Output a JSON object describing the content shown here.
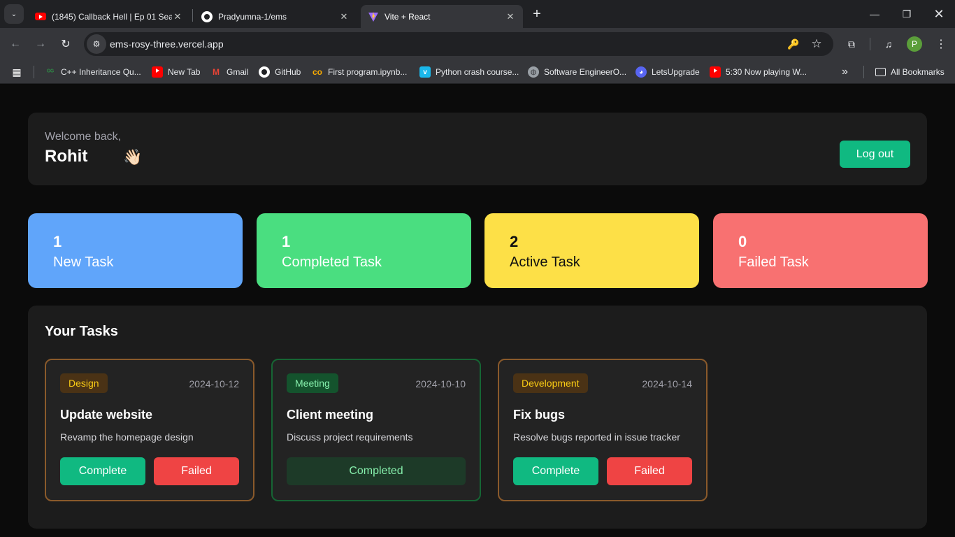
{
  "browser": {
    "tabs": [
      {
        "title": "(1845) Callback Hell | Ep 01 Sea",
        "favicon": "youtube-icon"
      },
      {
        "title": "Pradyumna-1/ems",
        "favicon": "github-icon"
      },
      {
        "title": "Vite + React",
        "favicon": "vite-icon"
      }
    ],
    "url": "ems-rosy-three.vercel.app",
    "profile_initial": "P",
    "bookmarks": [
      {
        "label": "C++ Inheritance Qu...",
        "icon": "gfg-icon"
      },
      {
        "label": "New Tab",
        "icon": "youtube-icon"
      },
      {
        "label": "Gmail",
        "icon": "gmail-icon"
      },
      {
        "label": "GitHub",
        "icon": "github-icon"
      },
      {
        "label": "First program.ipynb...",
        "icon": "colab-icon"
      },
      {
        "label": "Python crash course...",
        "icon": "vimeo-icon"
      },
      {
        "label": "Software EngineerO...",
        "icon": "globe-icon"
      },
      {
        "label": "LetsUpgrade",
        "icon": "discord-icon"
      },
      {
        "label": "5:30 Now playing W...",
        "icon": "youtube-icon"
      }
    ],
    "all_bookmarks": "All Bookmarks"
  },
  "header": {
    "welcome": "Welcome back,",
    "name": "Rohit",
    "wave": "👋🏻",
    "logout": "Log out"
  },
  "stats": [
    {
      "count": "1",
      "label": "New Task",
      "color": "#60a5fa"
    },
    {
      "count": "1",
      "label": "Completed Task",
      "color": "#4ade80"
    },
    {
      "count": "2",
      "label": "Active Task",
      "color": "#fde047"
    },
    {
      "count": "0",
      "label": "Failed Task",
      "color": "#f87171"
    }
  ],
  "tasks": {
    "title": "Your Tasks",
    "items": [
      {
        "category": "Design",
        "date": "2024-10-12",
        "title": "Update website",
        "description": "Revamp the homepage design",
        "complete": "Complete",
        "failed": "Failed"
      },
      {
        "category": "Meeting",
        "date": "2024-10-10",
        "title": "Client meeting",
        "description": "Discuss project requirements",
        "status": "Completed"
      },
      {
        "category": "Development",
        "date": "2024-10-14",
        "title": "Fix bugs",
        "description": "Resolve bugs reported in issue tracker",
        "complete": "Complete",
        "failed": "Failed"
      }
    ]
  }
}
